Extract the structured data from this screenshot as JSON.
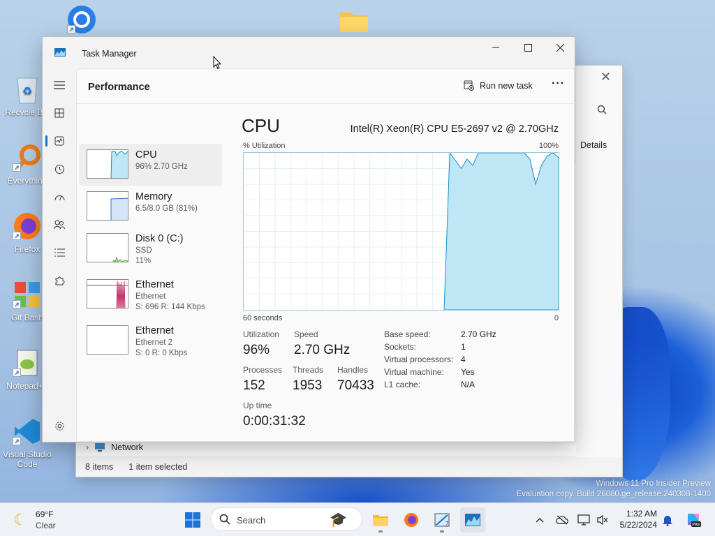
{
  "desktop": {
    "icons": [
      {
        "label": "",
        "icon": "chrome-icon"
      },
      {
        "label": "",
        "icon": "folder-icon"
      },
      {
        "label": "Recycle Bin",
        "icon": "recycle-bin-icon"
      },
      {
        "label": "Everything",
        "icon": "everything-search-icon"
      },
      {
        "label": "Firefox",
        "icon": "firefox-icon"
      },
      {
        "label": "Git Bash",
        "icon": "git-bash-icon"
      },
      {
        "label": "Notepad++",
        "icon": "notepad-plus-plus-icon"
      },
      {
        "label": "Visual Studio Code",
        "icon": "vscode-icon"
      }
    ],
    "watermark_line1": "Windows 11 Pro Insider Preview",
    "watermark_line2": "Evaluation copy. Build 26080.ge_release.240308-1400"
  },
  "explorer": {
    "details_label": "Details",
    "network_label": "Network",
    "status_items": "8 items",
    "status_selected": "1 item selected"
  },
  "taskmanager": {
    "title": "Task Manager",
    "page_title": "Performance",
    "run_new_task": "Run new task",
    "more": "···",
    "devices": [
      {
        "name": "CPU",
        "sub1": "96%  2.70 GHz",
        "sub2": "",
        "sub3": ""
      },
      {
        "name": "Memory",
        "sub1": "6.5/8.0 GB (81%)",
        "sub2": "",
        "sub3": ""
      },
      {
        "name": "Disk 0 (C:)",
        "sub1": "SSD",
        "sub2": "11%",
        "sub3": ""
      },
      {
        "name": "Ethernet",
        "sub1": "Ethernet",
        "sub2": "S: 696  R: 144 Kbps",
        "sub3": ""
      },
      {
        "name": "Ethernet",
        "sub1": "Ethernet 2",
        "sub2": "S: 0  R: 0 Kbps",
        "sub3": ""
      }
    ],
    "cpu": {
      "heading": "CPU",
      "model": "Intel(R) Xeon(R) CPU E5-2697 v2 @ 2.70GHz",
      "util_label": "% Utilization",
      "util_max": "100%",
      "axis_left": "60 seconds",
      "axis_right": "0",
      "stats": {
        "utilization_label": "Utilization",
        "utilization": "96%",
        "speed_label": "Speed",
        "speed": "2.70 GHz",
        "processes_label": "Processes",
        "processes": "152",
        "threads_label": "Threads",
        "threads": "1953",
        "handles_label": "Handles",
        "handles": "70433",
        "uptime_label": "Up time",
        "uptime": "0:00:31:32"
      },
      "details": [
        {
          "k": "Base speed:",
          "v": "2.70 GHz"
        },
        {
          "k": "Sockets:",
          "v": "1"
        },
        {
          "k": "Virtual processors:",
          "v": "4"
        },
        {
          "k": "Virtual machine:",
          "v": "Yes"
        },
        {
          "k": "L1 cache:",
          "v": "N/A"
        }
      ],
      "graph_fill": "#bfe6f5",
      "graph_stroke": "#1a8fc4",
      "history_percent": [
        0,
        0,
        0,
        0,
        0,
        0,
        0,
        0,
        0,
        0,
        0,
        0,
        0,
        0,
        0,
        0,
        0,
        0,
        0,
        0,
        0,
        0,
        0,
        0,
        0,
        0,
        0,
        0,
        0,
        0,
        0,
        0,
        0,
        0,
        0,
        0,
        100,
        95,
        90,
        96,
        92,
        100,
        100,
        100,
        100,
        100,
        100,
        100,
        100,
        100,
        96,
        80,
        92,
        98,
        100,
        97
      ]
    }
  },
  "taskbar": {
    "weather_temp": "69°F",
    "weather_cond": "Clear",
    "search_placeholder": "Search",
    "time": "1:32 AM",
    "date": "5/22/2024"
  }
}
